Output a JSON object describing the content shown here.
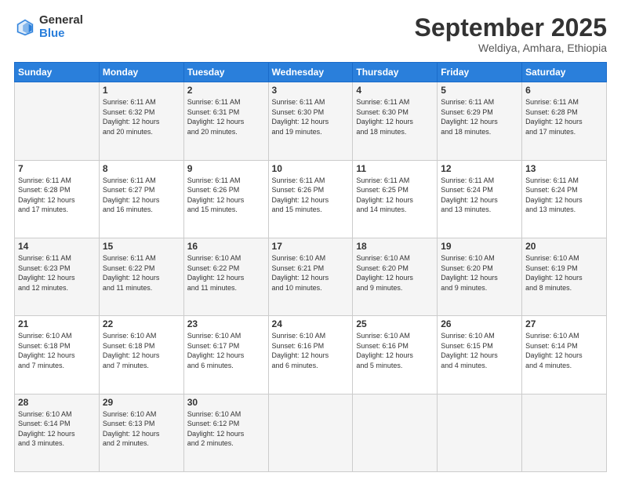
{
  "logo": {
    "general": "General",
    "blue": "Blue"
  },
  "header": {
    "month": "September 2025",
    "location": "Weldiya, Amhara, Ethiopia"
  },
  "days_of_week": [
    "Sunday",
    "Monday",
    "Tuesday",
    "Wednesday",
    "Thursday",
    "Friday",
    "Saturday"
  ],
  "weeks": [
    [
      {
        "day": "",
        "info": ""
      },
      {
        "day": "1",
        "info": "Sunrise: 6:11 AM\nSunset: 6:32 PM\nDaylight: 12 hours\nand 20 minutes."
      },
      {
        "day": "2",
        "info": "Sunrise: 6:11 AM\nSunset: 6:31 PM\nDaylight: 12 hours\nand 20 minutes."
      },
      {
        "day": "3",
        "info": "Sunrise: 6:11 AM\nSunset: 6:30 PM\nDaylight: 12 hours\nand 19 minutes."
      },
      {
        "day": "4",
        "info": "Sunrise: 6:11 AM\nSunset: 6:30 PM\nDaylight: 12 hours\nand 18 minutes."
      },
      {
        "day": "5",
        "info": "Sunrise: 6:11 AM\nSunset: 6:29 PM\nDaylight: 12 hours\nand 18 minutes."
      },
      {
        "day": "6",
        "info": "Sunrise: 6:11 AM\nSunset: 6:28 PM\nDaylight: 12 hours\nand 17 minutes."
      }
    ],
    [
      {
        "day": "7",
        "info": "Sunrise: 6:11 AM\nSunset: 6:28 PM\nDaylight: 12 hours\nand 17 minutes."
      },
      {
        "day": "8",
        "info": "Sunrise: 6:11 AM\nSunset: 6:27 PM\nDaylight: 12 hours\nand 16 minutes."
      },
      {
        "day": "9",
        "info": "Sunrise: 6:11 AM\nSunset: 6:26 PM\nDaylight: 12 hours\nand 15 minutes."
      },
      {
        "day": "10",
        "info": "Sunrise: 6:11 AM\nSunset: 6:26 PM\nDaylight: 12 hours\nand 15 minutes."
      },
      {
        "day": "11",
        "info": "Sunrise: 6:11 AM\nSunset: 6:25 PM\nDaylight: 12 hours\nand 14 minutes."
      },
      {
        "day": "12",
        "info": "Sunrise: 6:11 AM\nSunset: 6:24 PM\nDaylight: 12 hours\nand 13 minutes."
      },
      {
        "day": "13",
        "info": "Sunrise: 6:11 AM\nSunset: 6:24 PM\nDaylight: 12 hours\nand 13 minutes."
      }
    ],
    [
      {
        "day": "14",
        "info": "Sunrise: 6:11 AM\nSunset: 6:23 PM\nDaylight: 12 hours\nand 12 minutes."
      },
      {
        "day": "15",
        "info": "Sunrise: 6:11 AM\nSunset: 6:22 PM\nDaylight: 12 hours\nand 11 minutes."
      },
      {
        "day": "16",
        "info": "Sunrise: 6:10 AM\nSunset: 6:22 PM\nDaylight: 12 hours\nand 11 minutes."
      },
      {
        "day": "17",
        "info": "Sunrise: 6:10 AM\nSunset: 6:21 PM\nDaylight: 12 hours\nand 10 minutes."
      },
      {
        "day": "18",
        "info": "Sunrise: 6:10 AM\nSunset: 6:20 PM\nDaylight: 12 hours\nand 9 minutes."
      },
      {
        "day": "19",
        "info": "Sunrise: 6:10 AM\nSunset: 6:20 PM\nDaylight: 12 hours\nand 9 minutes."
      },
      {
        "day": "20",
        "info": "Sunrise: 6:10 AM\nSunset: 6:19 PM\nDaylight: 12 hours\nand 8 minutes."
      }
    ],
    [
      {
        "day": "21",
        "info": "Sunrise: 6:10 AM\nSunset: 6:18 PM\nDaylight: 12 hours\nand 7 minutes."
      },
      {
        "day": "22",
        "info": "Sunrise: 6:10 AM\nSunset: 6:18 PM\nDaylight: 12 hours\nand 7 minutes."
      },
      {
        "day": "23",
        "info": "Sunrise: 6:10 AM\nSunset: 6:17 PM\nDaylight: 12 hours\nand 6 minutes."
      },
      {
        "day": "24",
        "info": "Sunrise: 6:10 AM\nSunset: 6:16 PM\nDaylight: 12 hours\nand 6 minutes."
      },
      {
        "day": "25",
        "info": "Sunrise: 6:10 AM\nSunset: 6:16 PM\nDaylight: 12 hours\nand 5 minutes."
      },
      {
        "day": "26",
        "info": "Sunrise: 6:10 AM\nSunset: 6:15 PM\nDaylight: 12 hours\nand 4 minutes."
      },
      {
        "day": "27",
        "info": "Sunrise: 6:10 AM\nSunset: 6:14 PM\nDaylight: 12 hours\nand 4 minutes."
      }
    ],
    [
      {
        "day": "28",
        "info": "Sunrise: 6:10 AM\nSunset: 6:14 PM\nDaylight: 12 hours\nand 3 minutes."
      },
      {
        "day": "29",
        "info": "Sunrise: 6:10 AM\nSunset: 6:13 PM\nDaylight: 12 hours\nand 2 minutes."
      },
      {
        "day": "30",
        "info": "Sunrise: 6:10 AM\nSunset: 6:12 PM\nDaylight: 12 hours\nand 2 minutes."
      },
      {
        "day": "",
        "info": ""
      },
      {
        "day": "",
        "info": ""
      },
      {
        "day": "",
        "info": ""
      },
      {
        "day": "",
        "info": ""
      }
    ]
  ]
}
